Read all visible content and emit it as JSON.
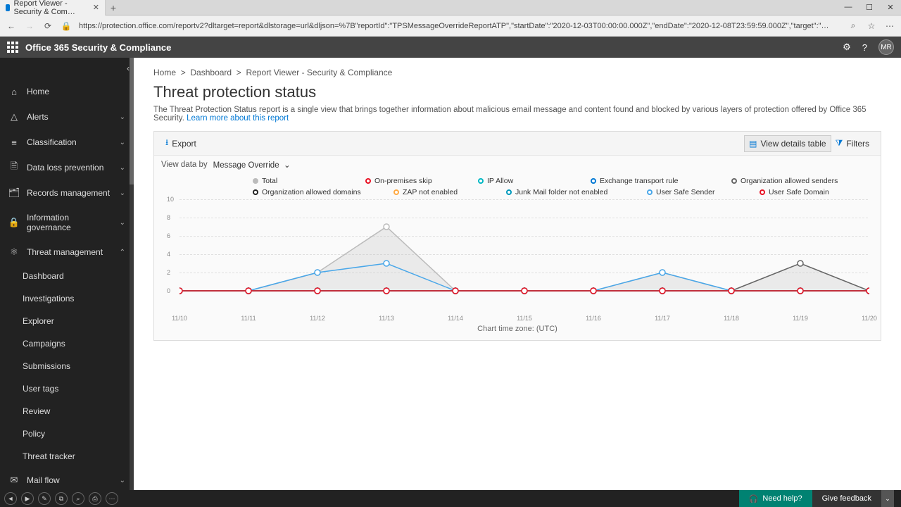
{
  "browser": {
    "tab_title": "Report Viewer - Security & Com…",
    "url": "https://protection.office.com/reportv2?dltarget=report&dlstorage=url&dljson=%7B\"reportId\":\"TPSMessageOverrideReportATP\",\"startDate\":\"2020-12-03T00:00:00.000Z\",\"endDate\":\"2020-12-08T23:59:59.000Z\",\"target\":\"…"
  },
  "header": {
    "product": "Office 365 Security & Compliance",
    "avatar": "MR"
  },
  "sidebar": {
    "items": [
      {
        "label": "Home",
        "icon": "home"
      },
      {
        "label": "Alerts",
        "icon": "alert",
        "expand": true
      },
      {
        "label": "Classification",
        "icon": "class",
        "expand": true
      },
      {
        "label": "Data loss prevention",
        "icon": "dlp",
        "expand": true
      },
      {
        "label": "Records management",
        "icon": "records",
        "expand": true
      },
      {
        "label": "Information governance",
        "icon": "lock",
        "expand": true
      },
      {
        "label": "Threat management",
        "icon": "threat",
        "expand": true,
        "open": true
      },
      {
        "label": "Mail flow",
        "icon": "mail",
        "expand": true
      }
    ],
    "threat_sub": [
      "Dashboard",
      "Investigations",
      "Explorer",
      "Campaigns",
      "Submissions",
      "User tags",
      "Review",
      "Policy",
      "Threat tracker"
    ]
  },
  "breadcrumb": {
    "a": "Home",
    "b": "Dashboard",
    "c": "Report Viewer - Security & Compliance",
    "sep": ">"
  },
  "page": {
    "title": "Threat protection status",
    "desc": "The Threat Protection Status report is a single view that brings together information about malicious email message and content found and blocked by various layers of protection offered by Office 365 Security.",
    "learn": "Learn more about this report"
  },
  "toolbar": {
    "export": "Export",
    "view_table": "View details table",
    "filters": "Filters",
    "view_by_label": "View data by",
    "view_by_value": "Message Override"
  },
  "legend_items": [
    {
      "label": "Total",
      "color": "#bbbbbb",
      "fill": "#bbbbbb"
    },
    {
      "label": "On-premises skip",
      "color": "#e81123"
    },
    {
      "label": "IP Allow",
      "color": "#00b7c3"
    },
    {
      "label": "Exchange transport rule",
      "color": "#0078d4"
    },
    {
      "label": "Organization allowed senders",
      "color": "#666666"
    },
    {
      "label": "Organization allowed domains",
      "color": "#222222"
    },
    {
      "label": "ZAP not enabled",
      "color": "#ffaa44"
    },
    {
      "label": "Junk Mail folder not enabled",
      "color": "#0099bc"
    },
    {
      "label": "User Safe Sender",
      "color": "#49a7e9"
    },
    {
      "label": "User Safe Domain",
      "color": "#e81123"
    }
  ],
  "chart_data": {
    "type": "line",
    "xlabel": "",
    "ylabel": "",
    "ylim": [
      0,
      10
    ],
    "yticks": [
      0,
      2,
      4,
      6,
      8,
      10
    ],
    "categories": [
      "11/10",
      "11/11",
      "11/12",
      "11/13",
      "11/14",
      "11/15",
      "11/16",
      "11/17",
      "11/18",
      "11/19",
      "11/20"
    ],
    "series": [
      {
        "name": "Total",
        "values": [
          0,
          0,
          2,
          7,
          0,
          0,
          0,
          2,
          0,
          3,
          0
        ],
        "color": "#bbbbbb",
        "area": true
      },
      {
        "name": "User Safe Sender",
        "values": [
          0,
          0,
          2,
          3,
          0,
          0,
          0,
          2,
          0,
          0,
          0
        ],
        "color": "#49a7e9"
      },
      {
        "name": "Organization allowed senders",
        "values": [
          0,
          0,
          0,
          0,
          0,
          0,
          0,
          0,
          0,
          3,
          0
        ],
        "color": "#666666"
      },
      {
        "name": "On-premises skip",
        "values": [
          0,
          0,
          0,
          0,
          0,
          0,
          0,
          0,
          0,
          0,
          0
        ],
        "color": "#e81123"
      },
      {
        "name": "IP Allow",
        "values": [
          0,
          0,
          0,
          0,
          0,
          0,
          0,
          0,
          0,
          0,
          0
        ],
        "color": "#00b7c3"
      },
      {
        "name": "Exchange transport rule",
        "values": [
          0,
          0,
          0,
          0,
          0,
          0,
          0,
          0,
          0,
          0,
          0
        ],
        "color": "#0078d4"
      },
      {
        "name": "Organization allowed domains",
        "values": [
          0,
          0,
          0,
          0,
          0,
          0,
          0,
          0,
          0,
          0,
          0
        ],
        "color": "#222222"
      },
      {
        "name": "ZAP not enabled",
        "values": [
          0,
          0,
          0,
          0,
          0,
          0,
          0,
          0,
          0,
          0,
          0
        ],
        "color": "#ffaa44"
      },
      {
        "name": "Junk Mail folder not enabled",
        "values": [
          0,
          0,
          0,
          0,
          0,
          0,
          0,
          0,
          0,
          0,
          0
        ],
        "color": "#0099bc"
      },
      {
        "name": "User Safe Domain",
        "values": [
          0,
          0,
          0,
          0,
          0,
          0,
          0,
          0,
          0,
          0,
          0
        ],
        "color": "#e81123"
      }
    ],
    "timezone_note": "Chart time zone: (UTC)"
  },
  "footer": {
    "need_help": "Need help?",
    "feedback": "Give feedback"
  }
}
